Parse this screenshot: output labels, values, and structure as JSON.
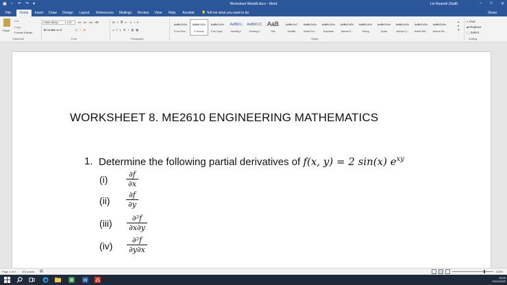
{
  "window": {
    "title": "Worksheet Week8.docx  -  Word",
    "user": "Lin Nnamdi (Staff)",
    "controls": [
      "–",
      "□",
      "✕"
    ]
  },
  "tabs": [
    "File",
    "Home",
    "Insert",
    "Draw",
    "Design",
    "Layout",
    "References",
    "Mailings",
    "Review",
    "View",
    "Help",
    "Acrobat"
  ],
  "tell_me": "Tell me what you want to do",
  "share": "Share",
  "clipboard": {
    "paste": "Paste",
    "cut": "Cut",
    "copy": "Copy",
    "format_painter": "Format Painter",
    "label": "Clipboard"
  },
  "font": {
    "name": "Calibri (Body)",
    "size": "18",
    "label": "Font",
    "buttons": "B  I  U  abc  x₂  x²"
  },
  "paragraph": {
    "label": "Paragraph"
  },
  "styles_group": {
    "label": "Styles",
    "items": [
      {
        "sample": "AaBbCcDc",
        "name": "¶ List Para..."
      },
      {
        "sample": "AaBbCcDc",
        "name": "¶ Normal"
      },
      {
        "sample": "AaBbCcDc",
        "name": "¶ No Spac..."
      },
      {
        "sample": "AaBbCc",
        "name": "Heading 1"
      },
      {
        "sample": "AaBbCcC",
        "name": "Heading 2"
      },
      {
        "sample": "AaB",
        "name": "Title"
      },
      {
        "sample": "AaBbCcC",
        "name": "Subtitle"
      },
      {
        "sample": "AaBbCcDc",
        "name": "Subtle Em..."
      },
      {
        "sample": "AaBbCcDc",
        "name": "Emphasis"
      },
      {
        "sample": "AaBbCcDc",
        "name": "Intense E..."
      },
      {
        "sample": "AaBbCcDc",
        "name": "Strong"
      },
      {
        "sample": "AaBbCcDc",
        "name": "Quote"
      },
      {
        "sample": "AaBbCcDc",
        "name": "Intense Q..."
      },
      {
        "sample": "AaBbCcDc",
        "name": "Subtle Ref..."
      },
      {
        "sample": "AaBbCcDc",
        "name": "Intense Re..."
      }
    ]
  },
  "editing": {
    "label": "Editing",
    "find": "Find",
    "replace": "Replace",
    "select": "Select"
  },
  "document": {
    "heading": "WORKSHEET 8.  ME2610 ENGINEERING MATHEMATICS",
    "q1_number": "1.",
    "q1_text": "Determine the following partial derivatives of",
    "q1_function": "f(x, y) = 2 sin(x) e",
    "q1_exponent": "xy",
    "items": [
      {
        "label": "(i)",
        "num": "∂f",
        "den": "∂x"
      },
      {
        "label": "(ii)",
        "num": "∂f",
        "den": "∂y"
      },
      {
        "label": "(iii)",
        "num": "∂²f",
        "den": "∂x∂y"
      },
      {
        "label": "(iv)",
        "num": "∂²f",
        "den": "∂y∂x"
      }
    ]
  },
  "status": {
    "page": "Page 1 of 1",
    "words": "101 words",
    "zoom": "220%"
  },
  "taskbar": {
    "time": "18:05",
    "date": "23/11/2023"
  },
  "colors": {
    "word_blue": "#2b579a",
    "taskbar": "#1e2a3a"
  }
}
